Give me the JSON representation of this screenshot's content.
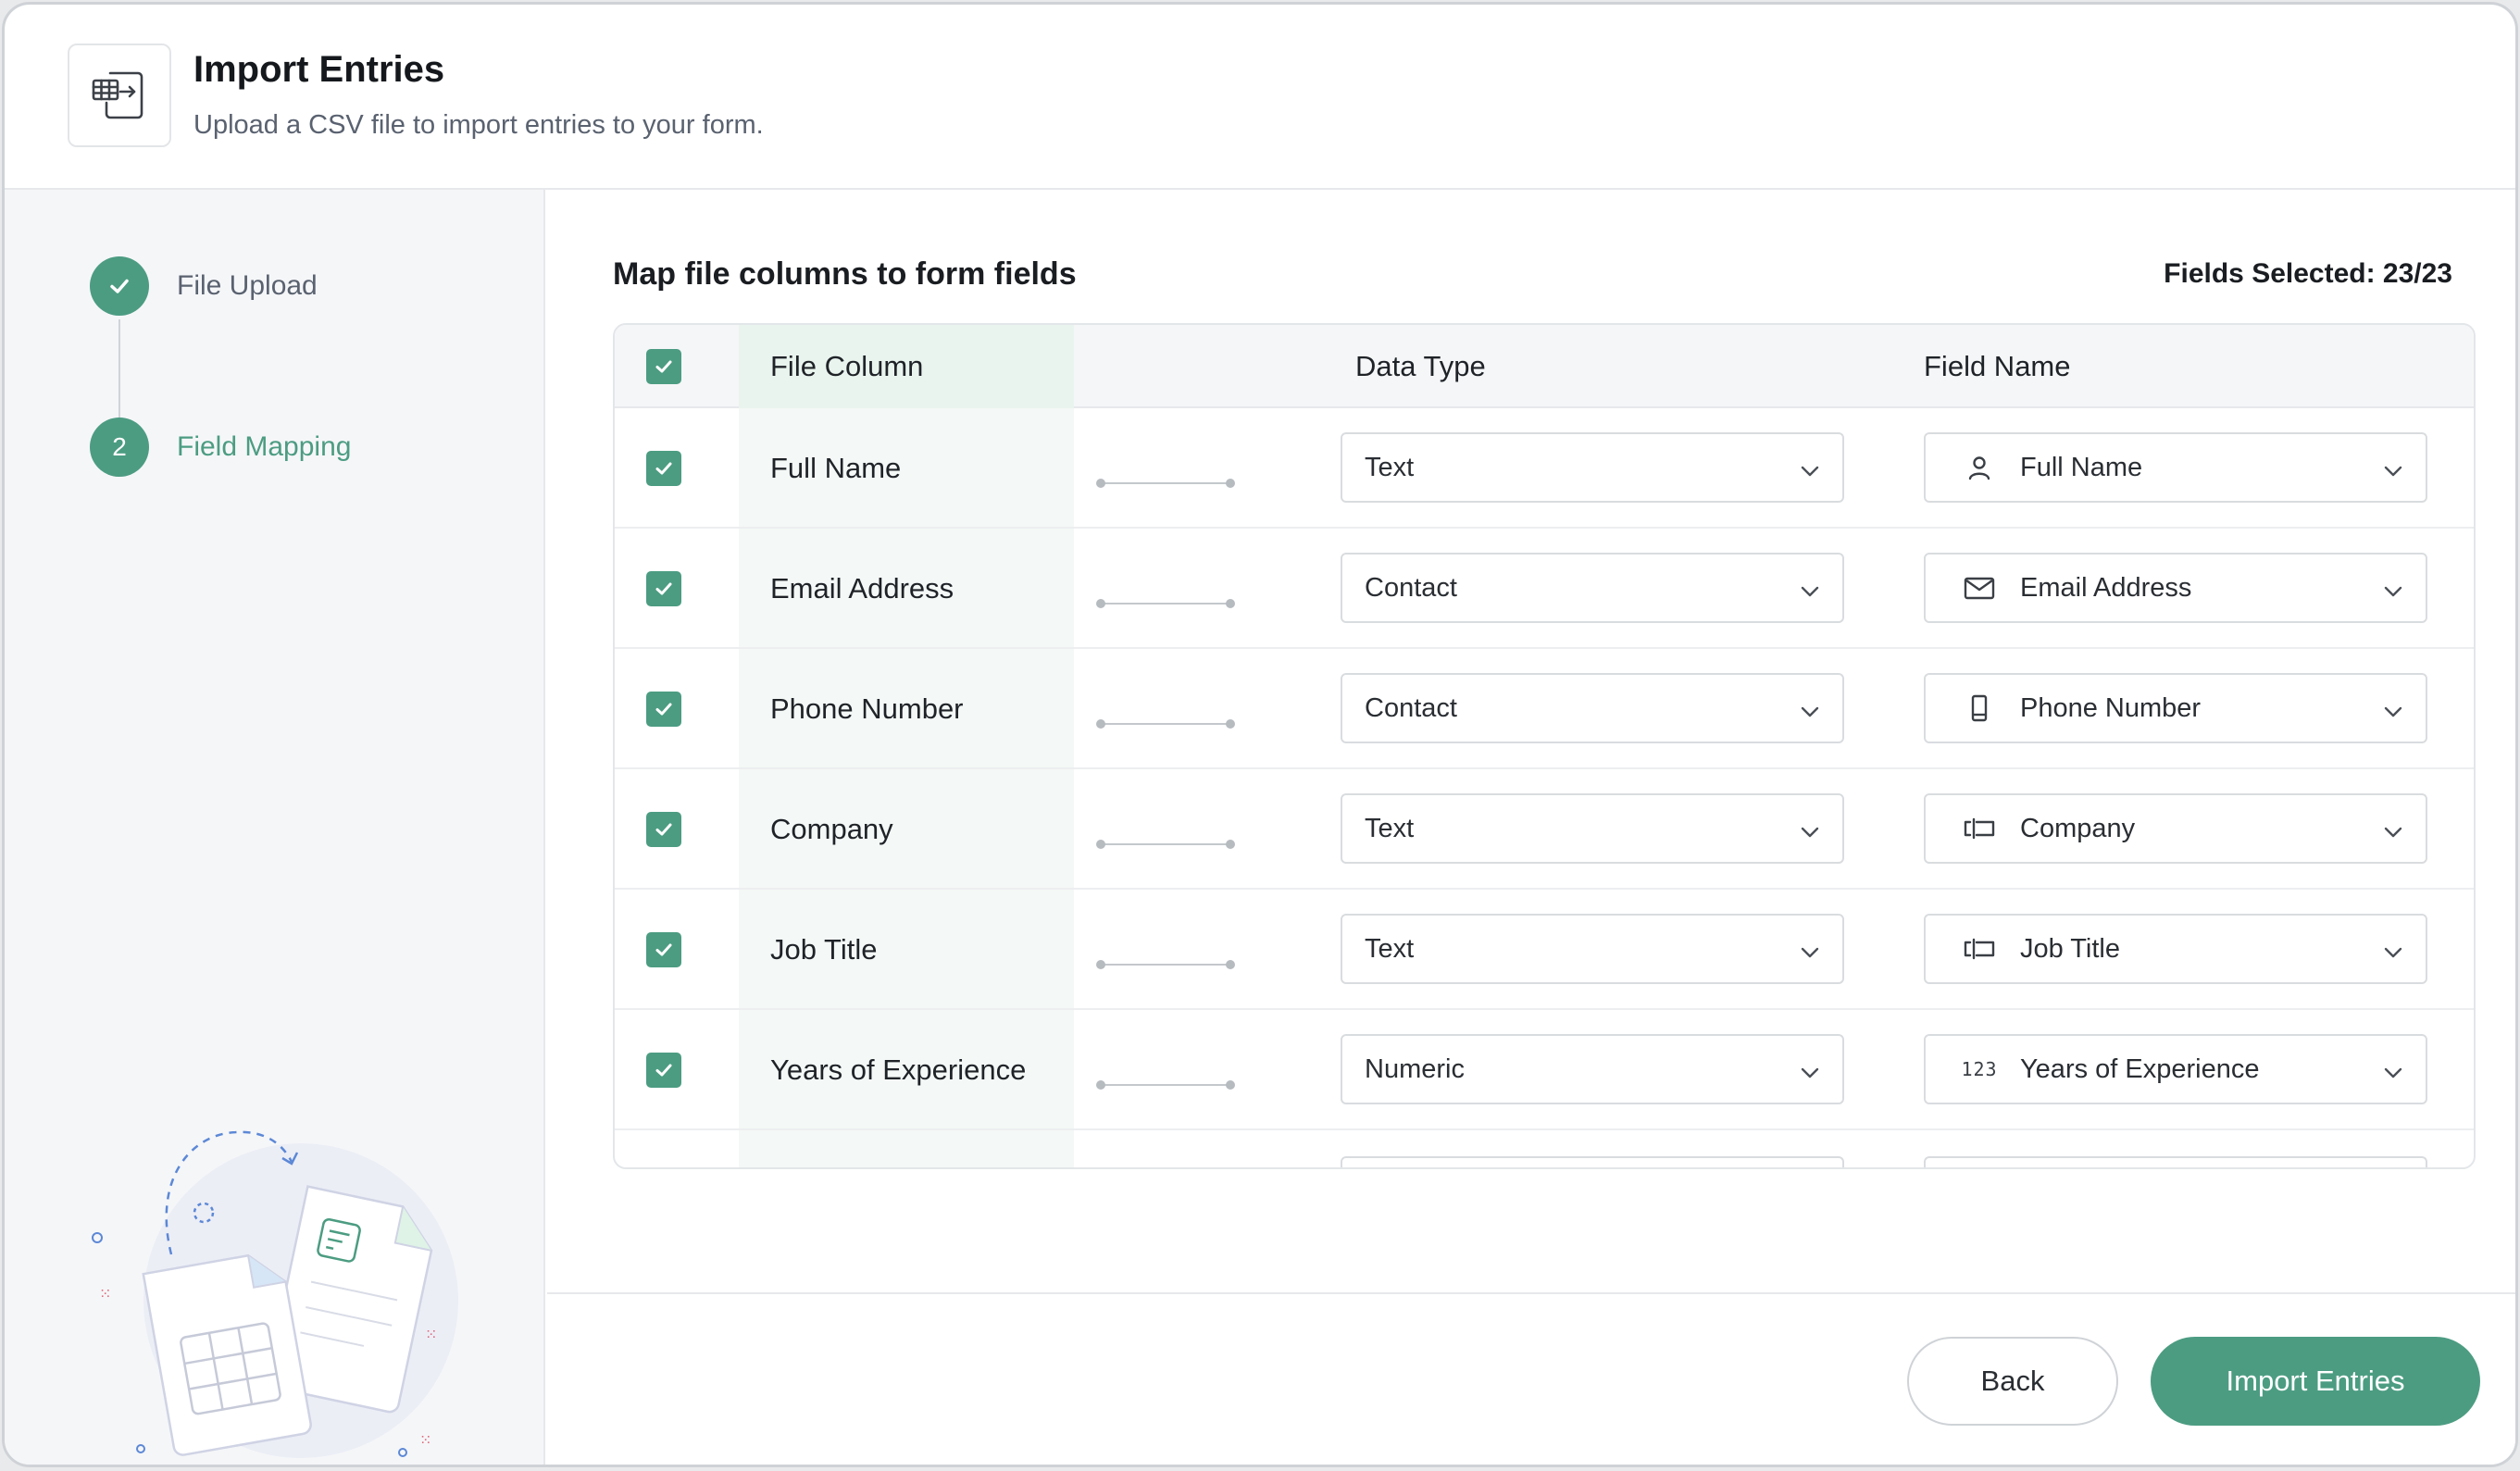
{
  "header": {
    "title": "Import Entries",
    "subtitle": "Upload a CSV file to import entries to your form.",
    "icon": "table-import-icon"
  },
  "sidebar": {
    "steps": [
      {
        "label": "File Upload",
        "state": "completed",
        "marker": "check"
      },
      {
        "label": "Field Mapping",
        "state": "active",
        "marker": "2"
      }
    ]
  },
  "main": {
    "title": "Map file columns to form fields",
    "fields_selected": "Fields Selected: 23/23",
    "columns": {
      "file_column": "File Column",
      "data_type": "Data Type",
      "field_name": "Field Name"
    },
    "rows": [
      {
        "file_column": "Full Name",
        "data_type": "Text",
        "field_name": "Full Name",
        "field_icon": "user-icon",
        "checked": true
      },
      {
        "file_column": "Email Address",
        "data_type": "Contact",
        "field_name": "Email Address",
        "field_icon": "envelope-icon",
        "checked": true
      },
      {
        "file_column": "Phone Number",
        "data_type": "Contact",
        "field_name": "Phone Number",
        "field_icon": "phone-icon",
        "checked": true
      },
      {
        "file_column": "Company",
        "data_type": "Text",
        "field_name": "Company",
        "field_icon": "text-input-icon",
        "checked": true
      },
      {
        "file_column": "Job Title",
        "data_type": "Text",
        "field_name": "Job Title",
        "field_icon": "text-input-icon",
        "checked": true
      },
      {
        "file_column": "Years of Experience",
        "data_type": "Numeric",
        "field_name": "Years of Experience",
        "field_icon": "numeric-icon",
        "field_icon_text": "123",
        "checked": true
      }
    ]
  },
  "footer": {
    "back_label": "Back",
    "import_label": "Import Entries"
  },
  "colors": {
    "accent": "#4c9c82",
    "border": "#d9dcdf",
    "sidebar_bg": "#f5f6f8"
  }
}
